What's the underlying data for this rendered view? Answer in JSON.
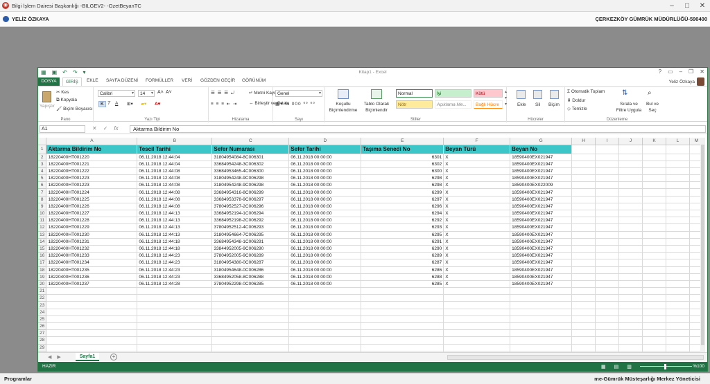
{
  "app": {
    "title": "Bilgi İşlem Dairesi Başkanlığı -BILGEV2- -OzetBeyanTC",
    "user": "YELİZ ÖZKAYA",
    "office": "ÇERKEZKÖY GÜMRÜK MÜDÜRLÜĞÜ-590400",
    "footer_left": "Programlar",
    "footer_right": "me-Gümrük Müsteşarlığı Merkez Yöneticisi"
  },
  "excel": {
    "window_title": "Kitap1 - Excel",
    "user_name": "Yeliz Özkaya",
    "tabs": [
      "DOSYA",
      "GİRİŞ",
      "EKLE",
      "SAYFA DÜZENİ",
      "FORMÜLLER",
      "VERİ",
      "GÖZDEN GEÇİR",
      "GÖRÜNÜM"
    ],
    "ribbon": {
      "clipboard": {
        "paste": "Yapıştır",
        "cut": "Kes",
        "copy": "Kopyala",
        "format_painter": "Biçim Boyacısı",
        "label": "Pano"
      },
      "font": {
        "name": "Calibri",
        "size": "14",
        "bold": "K",
        "italic": "T",
        "underline": "A",
        "label": "Yazı Tipi"
      },
      "alignment": {
        "wrap": "Metni Kaydır",
        "merge": "Birleştir ve Ortala",
        "label": "Hizalama"
      },
      "number": {
        "format": "Genel",
        "label": "Sayı"
      },
      "styles": {
        "conditional": "Koşullu Biçimlendirme",
        "table": "Tablo Olarak Biçimlendir",
        "normal": "Normal",
        "good": "İyi",
        "bad": "Kötü",
        "neutral": "Nötr",
        "explanatory": "Açıklama Me...",
        "linked": "Bağlı Hücre",
        "label": "Stiller"
      },
      "cells": {
        "insert": "Ekle",
        "delete": "Sil",
        "format": "Biçim",
        "label": "Hücreler"
      },
      "editing": {
        "autosum": "Otomatik Toplam",
        "fill": "Doldur",
        "clear": "Temizle",
        "sort": "Sırala ve Filtre Uygula",
        "find": "Bul ve Seç",
        "label": "Düzenleme"
      }
    },
    "name_box": "A1",
    "formula": "Aktarma Bildirim No",
    "columns": [
      "A",
      "B",
      "C",
      "D",
      "E",
      "F",
      "G",
      "H",
      "I",
      "J",
      "K",
      "L",
      "M"
    ],
    "headers": [
      "Aktarma Bildirim No",
      "Tescil Tarihi",
      "Sefer Numarası",
      "Sefer Tarihi",
      "Taşıma Senedi No",
      "Beyan Türü",
      "Beyan No"
    ],
    "rows": [
      [
        "18220400HT001220",
        "06.11.2018 12:44:04",
        "31804954084-8C006301",
        "06.11.2018 00:00:00",
        "6301",
        "X",
        "18590400EX021947"
      ],
      [
        "18220400HT001221",
        "06.11.2018 12:44:04",
        "33684954248-3C006302",
        "06.11.2018 00:00:00",
        "6302",
        "X",
        "18590400EX021947"
      ],
      [
        "18220400HT001222",
        "06.11.2018 12:44:08",
        "33684953465-4C006300",
        "06.11.2018 00:00:00",
        "6300",
        "X",
        "18590400EX021947"
      ],
      [
        "18220400HT001223",
        "06.11.2018 12:44:08",
        "31804954248-9C006298",
        "06.11.2018 00:00:00",
        "6298",
        "X",
        "18590400EX021947"
      ],
      [
        "18220400HT001223",
        "06.11.2018 12:44:08",
        "31804954248-9C006298",
        "06.11.2018 00:00:00",
        "6298",
        "X",
        "18590400EX022009"
      ],
      [
        "18220400HT001224",
        "06.11.2018 12:44:08",
        "33684954316-8C006299",
        "06.11.2018 00:00:00",
        "6299",
        "X",
        "18590400EX021947"
      ],
      [
        "18220400HT001225",
        "06.11.2018 12:44:08",
        "33684953378-9C006297",
        "06.11.2018 00:00:00",
        "6297",
        "X",
        "18590400EX021947"
      ],
      [
        "18220400HT001226",
        "06.11.2018 12:44:08",
        "37804952527-2C006296",
        "06.11.2018 00:00:00",
        "6296",
        "X",
        "18590400EX021947"
      ],
      [
        "18220400HT001227",
        "06.11.2018 12:44:13",
        "33684952194-1C006294",
        "06.11.2018 00:00:00",
        "6294",
        "X",
        "18590400EX021947"
      ],
      [
        "18220400HT001228",
        "06.11.2018 12:44:13",
        "33684952198-2C006292",
        "06.11.2018 00:00:00",
        "6292",
        "X",
        "18590400EX021947"
      ],
      [
        "18220400HT001229",
        "06.11.2018 12:44:13",
        "37804952512-4C006293",
        "06.11.2018 00:00:00",
        "6293",
        "X",
        "18590400EX021947"
      ],
      [
        "18220400HT001230",
        "06.11.2018 12:44:13",
        "31804954664-7C006295",
        "06.11.2018 00:00:00",
        "6295",
        "X",
        "18590400EX021947"
      ],
      [
        "18220400HT001231",
        "06.11.2018 12:44:18",
        "33684954348-1C006291",
        "06.11.2018 00:00:00",
        "6291",
        "X",
        "18590400EX021947"
      ],
      [
        "18220400HT001232",
        "06.11.2018 12:44:18",
        "33844952005-9C006290",
        "06.11.2018 00:00:00",
        "6290",
        "X",
        "18590400EX021947"
      ],
      [
        "18220400HT001233",
        "06.11.2018 12:44:23",
        "37804952005-9C006289",
        "06.11.2018 00:00:00",
        "6289",
        "X",
        "18590400EX021947"
      ],
      [
        "18220400HT001234",
        "06.11.2018 12:44:23",
        "31804954380-0C006287",
        "06.11.2018 00:00:00",
        "6287",
        "X",
        "18590400EX021947"
      ],
      [
        "18220400HT001235",
        "06.11.2018 12:44:23",
        "31804954648-0C006286",
        "06.11.2018 00:00:00",
        "6286",
        "X",
        "18590400EX021947"
      ],
      [
        "18220400HT001236",
        "06.11.2018 12:44:23",
        "33684952058-8C006288",
        "06.11.2018 00:00:00",
        "6288",
        "X",
        "18590400EX021947"
      ],
      [
        "18220400HT001237",
        "06.11.2018 12:44:28",
        "37804952298-0C006285",
        "06.11.2018 00:00:00",
        "6285",
        "X",
        "18590400EX021947"
      ]
    ],
    "sheet_tab": "Sayfa1",
    "status": "HAZIR",
    "zoom": "%100",
    "header_color": "#3cc6c7",
    "accent": "#217346"
  }
}
